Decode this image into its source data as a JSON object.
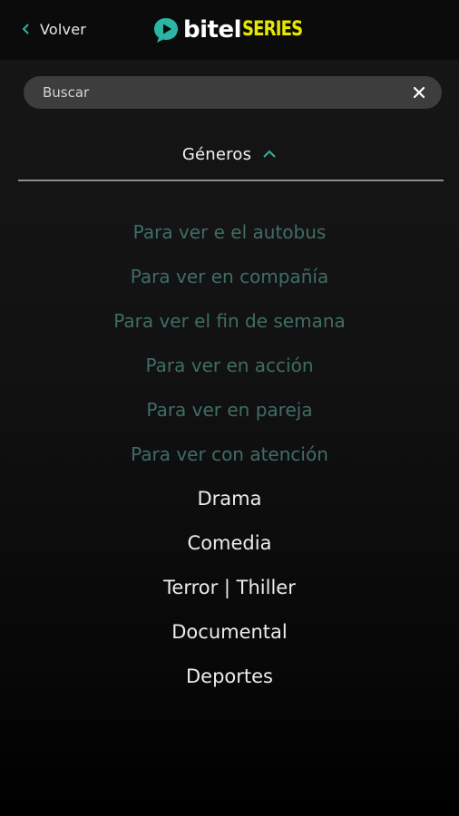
{
  "header": {
    "back_label": "Volver",
    "logo": {
      "text_primary": "bitel",
      "text_secondary": "SERIES",
      "mark_color": "#2bb5a4",
      "secondary_color": "#e7e600"
    }
  },
  "search": {
    "placeholder": "Buscar",
    "value": ""
  },
  "genres": {
    "title": "Géneros",
    "expanded": true,
    "sub_items": [
      {
        "label": "Para ver e el autobus"
      },
      {
        "label": "Para ver en compañía"
      },
      {
        "label": "Para ver el fin de semana"
      },
      {
        "label": "Para ver en acción"
      },
      {
        "label": "Para ver en pareja"
      },
      {
        "label": "Para ver con atención"
      }
    ],
    "main_items": [
      {
        "label": "Drama"
      },
      {
        "label": "Comedia"
      },
      {
        "label": "Terror | Thiller"
      },
      {
        "label": "Documental"
      },
      {
        "label": "Deportes"
      }
    ]
  },
  "colors": {
    "sub_item_text": "#3f6d66",
    "main_item_text": "#ececec",
    "accent": "#2bb5a4"
  },
  "icons": {
    "back": "chevron-left-icon",
    "clear": "close-icon",
    "expand": "chevron-up-icon"
  }
}
